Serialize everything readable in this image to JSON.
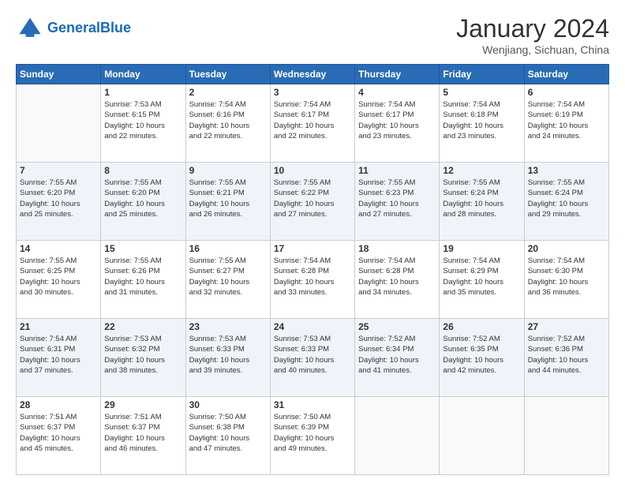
{
  "header": {
    "logo_general": "General",
    "logo_blue": "Blue",
    "month_year": "January 2024",
    "location": "Wenjiang, Sichuan, China"
  },
  "weekdays": [
    "Sunday",
    "Monday",
    "Tuesday",
    "Wednesday",
    "Thursday",
    "Friday",
    "Saturday"
  ],
  "weeks": [
    [
      {
        "day": "",
        "info": ""
      },
      {
        "day": "1",
        "info": "Sunrise: 7:53 AM\nSunset: 6:15 PM\nDaylight: 10 hours\nand 22 minutes."
      },
      {
        "day": "2",
        "info": "Sunrise: 7:54 AM\nSunset: 6:16 PM\nDaylight: 10 hours\nand 22 minutes."
      },
      {
        "day": "3",
        "info": "Sunrise: 7:54 AM\nSunset: 6:17 PM\nDaylight: 10 hours\nand 22 minutes."
      },
      {
        "day": "4",
        "info": "Sunrise: 7:54 AM\nSunset: 6:17 PM\nDaylight: 10 hours\nand 23 minutes."
      },
      {
        "day": "5",
        "info": "Sunrise: 7:54 AM\nSunset: 6:18 PM\nDaylight: 10 hours\nand 23 minutes."
      },
      {
        "day": "6",
        "info": "Sunrise: 7:54 AM\nSunset: 6:19 PM\nDaylight: 10 hours\nand 24 minutes."
      }
    ],
    [
      {
        "day": "7",
        "info": "Sunrise: 7:55 AM\nSunset: 6:20 PM\nDaylight: 10 hours\nand 25 minutes."
      },
      {
        "day": "8",
        "info": "Sunrise: 7:55 AM\nSunset: 6:20 PM\nDaylight: 10 hours\nand 25 minutes."
      },
      {
        "day": "9",
        "info": "Sunrise: 7:55 AM\nSunset: 6:21 PM\nDaylight: 10 hours\nand 26 minutes."
      },
      {
        "day": "10",
        "info": "Sunrise: 7:55 AM\nSunset: 6:22 PM\nDaylight: 10 hours\nand 27 minutes."
      },
      {
        "day": "11",
        "info": "Sunrise: 7:55 AM\nSunset: 6:23 PM\nDaylight: 10 hours\nand 27 minutes."
      },
      {
        "day": "12",
        "info": "Sunrise: 7:55 AM\nSunset: 6:24 PM\nDaylight: 10 hours\nand 28 minutes."
      },
      {
        "day": "13",
        "info": "Sunrise: 7:55 AM\nSunset: 6:24 PM\nDaylight: 10 hours\nand 29 minutes."
      }
    ],
    [
      {
        "day": "14",
        "info": "Sunrise: 7:55 AM\nSunset: 6:25 PM\nDaylight: 10 hours\nand 30 minutes."
      },
      {
        "day": "15",
        "info": "Sunrise: 7:55 AM\nSunset: 6:26 PM\nDaylight: 10 hours\nand 31 minutes."
      },
      {
        "day": "16",
        "info": "Sunrise: 7:55 AM\nSunset: 6:27 PM\nDaylight: 10 hours\nand 32 minutes."
      },
      {
        "day": "17",
        "info": "Sunrise: 7:54 AM\nSunset: 6:28 PM\nDaylight: 10 hours\nand 33 minutes."
      },
      {
        "day": "18",
        "info": "Sunrise: 7:54 AM\nSunset: 6:28 PM\nDaylight: 10 hours\nand 34 minutes."
      },
      {
        "day": "19",
        "info": "Sunrise: 7:54 AM\nSunset: 6:29 PM\nDaylight: 10 hours\nand 35 minutes."
      },
      {
        "day": "20",
        "info": "Sunrise: 7:54 AM\nSunset: 6:30 PM\nDaylight: 10 hours\nand 36 minutes."
      }
    ],
    [
      {
        "day": "21",
        "info": "Sunrise: 7:54 AM\nSunset: 6:31 PM\nDaylight: 10 hours\nand 37 minutes."
      },
      {
        "day": "22",
        "info": "Sunrise: 7:53 AM\nSunset: 6:32 PM\nDaylight: 10 hours\nand 38 minutes."
      },
      {
        "day": "23",
        "info": "Sunrise: 7:53 AM\nSunset: 6:33 PM\nDaylight: 10 hours\nand 39 minutes."
      },
      {
        "day": "24",
        "info": "Sunrise: 7:53 AM\nSunset: 6:33 PM\nDaylight: 10 hours\nand 40 minutes."
      },
      {
        "day": "25",
        "info": "Sunrise: 7:52 AM\nSunset: 6:34 PM\nDaylight: 10 hours\nand 41 minutes."
      },
      {
        "day": "26",
        "info": "Sunrise: 7:52 AM\nSunset: 6:35 PM\nDaylight: 10 hours\nand 42 minutes."
      },
      {
        "day": "27",
        "info": "Sunrise: 7:52 AM\nSunset: 6:36 PM\nDaylight: 10 hours\nand 44 minutes."
      }
    ],
    [
      {
        "day": "28",
        "info": "Sunrise: 7:51 AM\nSunset: 6:37 PM\nDaylight: 10 hours\nand 45 minutes."
      },
      {
        "day": "29",
        "info": "Sunrise: 7:51 AM\nSunset: 6:37 PM\nDaylight: 10 hours\nand 46 minutes."
      },
      {
        "day": "30",
        "info": "Sunrise: 7:50 AM\nSunset: 6:38 PM\nDaylight: 10 hours\nand 47 minutes."
      },
      {
        "day": "31",
        "info": "Sunrise: 7:50 AM\nSunset: 6:39 PM\nDaylight: 10 hours\nand 49 minutes."
      },
      {
        "day": "",
        "info": ""
      },
      {
        "day": "",
        "info": ""
      },
      {
        "day": "",
        "info": ""
      }
    ]
  ]
}
